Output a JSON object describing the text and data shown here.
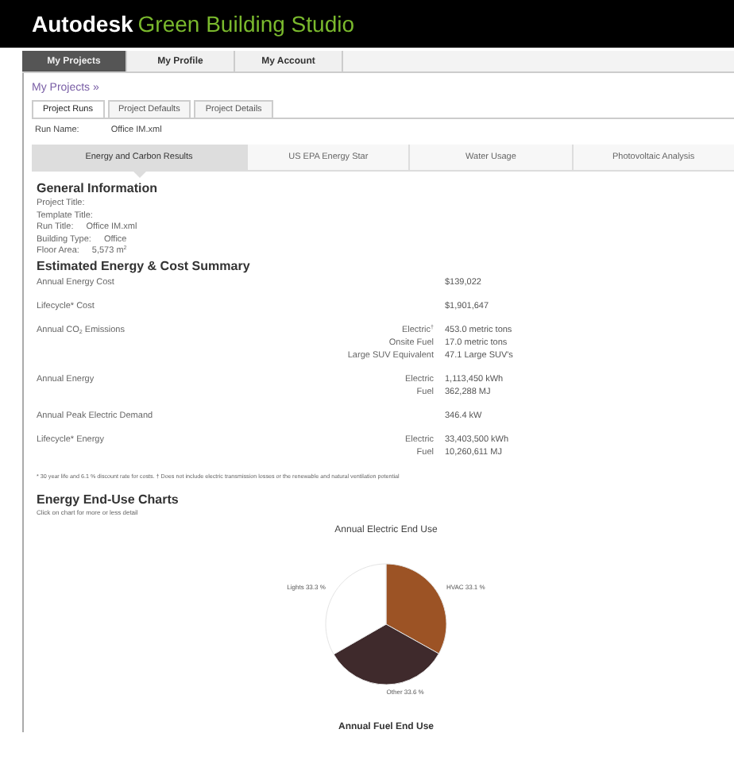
{
  "header": {
    "brand": "Autodesk",
    "product": "Green Building Studio"
  },
  "nav_tabs": [
    {
      "label": "My Projects",
      "selected": true
    },
    {
      "label": "My Profile",
      "selected": false
    },
    {
      "label": "My Account",
      "selected": false
    }
  ],
  "breadcrumb": "My Projects »",
  "sub_tabs": [
    {
      "label": "Project Runs",
      "selected": true
    },
    {
      "label": "Project Defaults",
      "selected": false
    },
    {
      "label": "Project Details",
      "selected": false
    }
  ],
  "run_name": {
    "label": "Run Name:",
    "value": "Office IM.xml"
  },
  "result_tabs": [
    {
      "label": "Energy and Carbon Results",
      "selected": true
    },
    {
      "label": "US EPA Energy Star",
      "selected": false
    },
    {
      "label": "Water Usage",
      "selected": false
    },
    {
      "label": "Photovoltaic Analysis",
      "selected": false
    }
  ],
  "general": {
    "title": "General Information",
    "fields": [
      {
        "label": "Project Title:"
      },
      {
        "label": "Template Title:"
      },
      {
        "label": "Run Title:",
        "value": "Office IM.xml"
      },
      {
        "label": "Building Type:",
        "value": "Office"
      },
      {
        "label": "Floor Area:",
        "value": "5,573 m$^{2}$"
      }
    ]
  },
  "summary": {
    "title": "Estimated Energy & Cost Summary",
    "rows": [
      {
        "label": "Annual Energy Cost",
        "value": "$139,022"
      },
      {
        "label": "Lifecycle* Cost",
        "value": "$1,901,647"
      },
      {
        "label": "Annual CO$_{2}$ Emissions",
        "details": [
          {
            "label": "Electric$^{†}$",
            "value": "453.0 metric tons"
          },
          {
            "label": "Onsite Fuel",
            "value": "17.0 metric tons"
          },
          {
            "label": "Large SUV Equivalent",
            "value": "47.1 Large SUV's"
          }
        ]
      },
      {
        "label": "Annual Energy",
        "details": [
          {
            "label": "Electric",
            "value": "1,113,450 kWh"
          },
          {
            "label": "Fuel",
            "value": "362,288 MJ"
          }
        ]
      },
      {
        "label": "Annual Peak Electric Demand",
        "value": "346.4 kW"
      },
      {
        "label": "Lifecycle* Energy",
        "details": [
          {
            "label": "Electric",
            "value": "33,403,500 kWh"
          },
          {
            "label": "Fuel",
            "value": "10,260,611 MJ"
          }
        ]
      }
    ],
    "footnote": "* 30 year life and 6.1 % discount rate for costs. † Does not include electric transmission losses or the renewable and natural ventilation potential"
  },
  "charts": {
    "title": "Energy End-Use Charts",
    "hint": "Click on chart for more or less detail",
    "chart_data": {
      "type": "pie",
      "title": "Annual Electric End Use",
      "categories": [
        "HVAC",
        "Other",
        "Lights"
      ],
      "values": [
        33.1,
        33.6,
        33.3
      ],
      "colors": [
        "#9c5325",
        "#3f2a2c",
        "#ffffff"
      ],
      "value_labels": [
        "33.1 %",
        "33.6 %",
        "33.3 %"
      ]
    },
    "next_chart_title": "Annual Fuel End Use"
  }
}
